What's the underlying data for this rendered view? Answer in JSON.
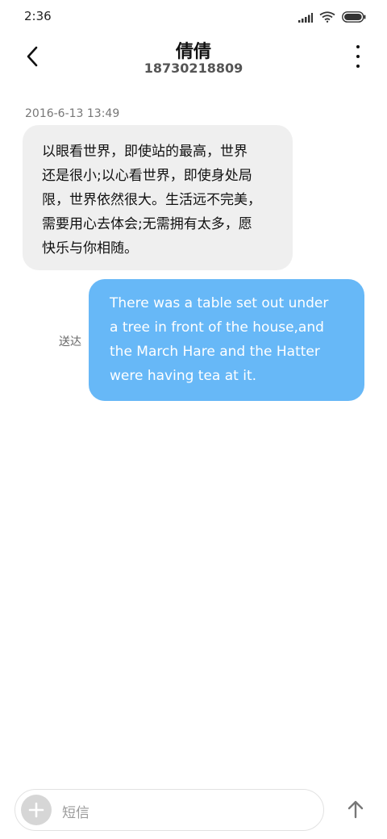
{
  "status_bar": {
    "time": "2:36",
    "icons": [
      "signal-icon",
      "wifi-icon",
      "battery-icon"
    ]
  },
  "header": {
    "contact_name": "倩倩",
    "contact_number": "18730218809"
  },
  "messages": [
    {
      "direction": "incoming",
      "timestamp": "2016-6-13 13:49",
      "lines": [
        "以眼看世界，即使站的最高，世界",
        "还是很小;以心看世界，即使身处局",
        "限，世界依然很大。生活远不完美，",
        "需要用心去体会;无需拥有太多，愿",
        "快乐与你相随。"
      ]
    },
    {
      "direction": "outgoing",
      "status": "送达",
      "lines": [
        "There was a table set out under",
        "a tree in front of the house,and",
        "the March Hare and the Hatter",
        "were having tea at it."
      ]
    }
  ],
  "composer": {
    "placeholder": "短信"
  },
  "colors": {
    "outgoing_bubble": "#67b8f7",
    "incoming_bubble": "#efefef",
    "background": "#ffffff"
  }
}
